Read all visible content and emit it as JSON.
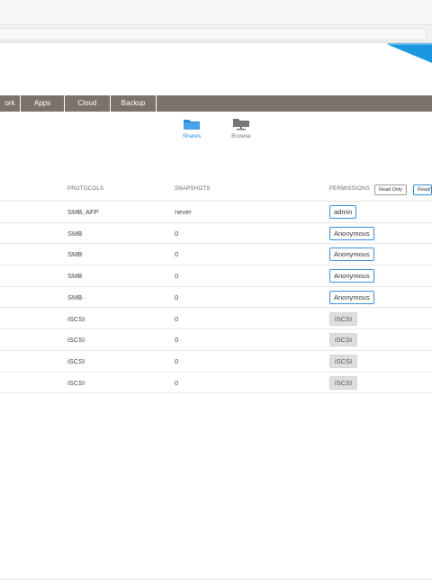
{
  "nav": {
    "items": [
      "ork",
      "Apps",
      "Cloud",
      "Backup"
    ]
  },
  "views": {
    "shares_label": "Shares",
    "browse_label": "Browse"
  },
  "table": {
    "headers": {
      "protocols": "PROTOCOLS",
      "snapshots": "SNAPSHOTS",
      "permissions": "PERMISSIONS"
    },
    "permission_toggles": [
      "Read Only",
      "Read/"
    ],
    "rows": [
      {
        "protocols": "SMB, AFP",
        "snapshots": "never",
        "permission": "admin",
        "kind": "user"
      },
      {
        "protocols": "SMB",
        "snapshots": "0",
        "permission": "Anonymous",
        "kind": "user"
      },
      {
        "protocols": "SMB",
        "snapshots": "0",
        "permission": "Anonymous",
        "kind": "user"
      },
      {
        "protocols": "SMB",
        "snapshots": "0",
        "permission": "Anonymous",
        "kind": "user"
      },
      {
        "protocols": "SMB",
        "snapshots": "0",
        "permission": "Anonymous",
        "kind": "user"
      },
      {
        "protocols": "iSCSI",
        "snapshots": "0",
        "permission": "iSCSI",
        "kind": "iscsi"
      },
      {
        "protocols": "iSCSI",
        "snapshots": "0",
        "permission": "iSCSI",
        "kind": "iscsi"
      },
      {
        "protocols": "iSCSI",
        "snapshots": "0",
        "permission": "iSCSI",
        "kind": "iscsi"
      },
      {
        "protocols": "iSCSI",
        "snapshots": "0",
        "permission": "iSCSI",
        "kind": "iscsi"
      }
    ]
  },
  "colors": {
    "nav_bg": "#7b726c",
    "accent": "#2b8ad8",
    "brand": "#1c96df"
  }
}
